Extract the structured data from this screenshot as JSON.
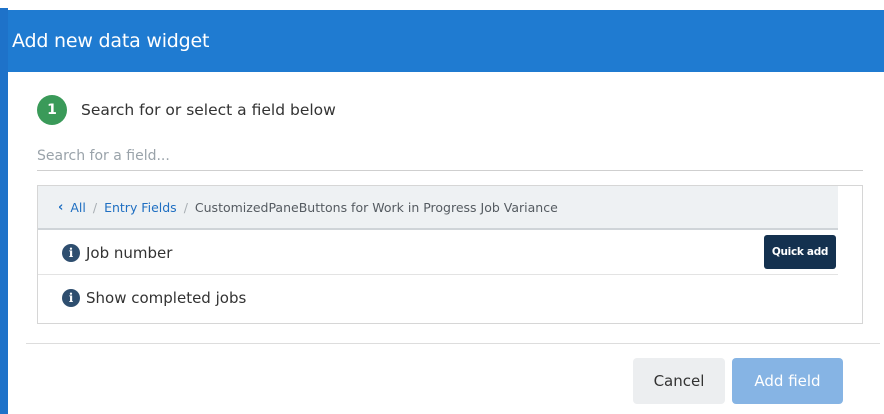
{
  "dialog": {
    "title": "Add new data widget"
  },
  "step": {
    "number": "1",
    "text": "Search for or select a field below"
  },
  "search": {
    "placeholder": "Search for a field...",
    "value": ""
  },
  "breadcrumb": {
    "back_icon": "chevron-left-icon",
    "items": [
      "All",
      "Entry Fields"
    ],
    "separator": "/",
    "current": "CustomizedPaneButtons for Work in Progress Job Variance"
  },
  "fields": [
    {
      "label": "Job number",
      "icon": "info-icon",
      "action": "Quick add"
    },
    {
      "label": "Show completed jobs",
      "icon": "info-icon"
    }
  ],
  "footer": {
    "cancel_label": "Cancel",
    "add_label": "Add field"
  },
  "colors": {
    "header": "#1f7bd1",
    "step_badge": "#3a9a59",
    "link": "#1f6fc2",
    "quick_add": "#14314f",
    "add_button_disabled": "#86b4e4"
  }
}
